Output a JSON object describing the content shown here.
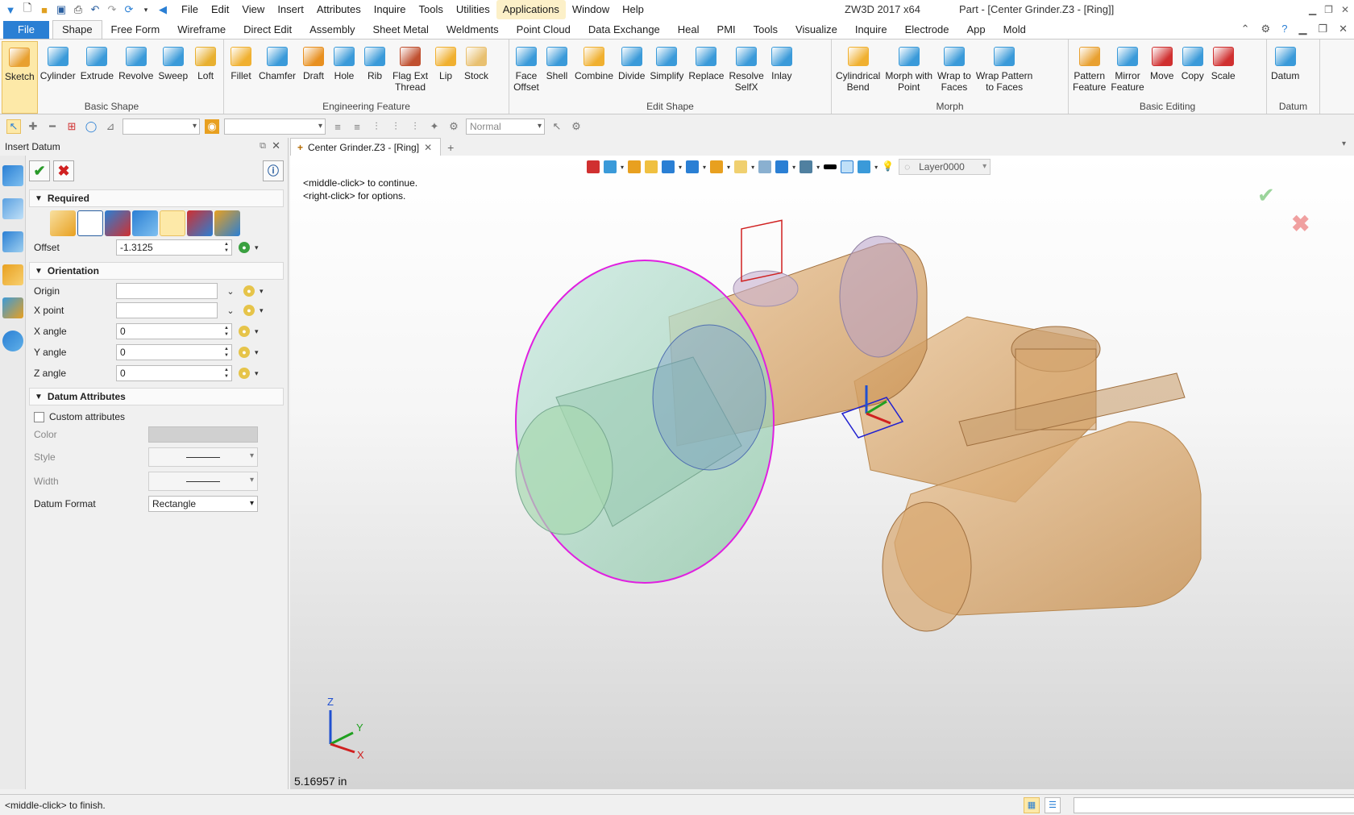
{
  "window": {
    "app_title": "ZW3D 2017  x64",
    "doc_title": "Part - [Center Grinder.Z3 - [Ring]]"
  },
  "menu": [
    "File",
    "Edit",
    "View",
    "Insert",
    "Attributes",
    "Inquire",
    "Tools",
    "Utilities",
    "Applications",
    "Window",
    "Help"
  ],
  "ribbon_tabs": [
    "File",
    "Shape",
    "Free Form",
    "Wireframe",
    "Direct Edit",
    "Assembly",
    "Sheet Metal",
    "Weldments",
    "Point Cloud",
    "Data Exchange",
    "Heal",
    "PMI",
    "Tools",
    "Visualize",
    "Inquire",
    "Electrode",
    "App",
    "Mold"
  ],
  "active_ribbon_tab": "Shape",
  "ribbon_groups": [
    {
      "label": "Basic Shape",
      "buttons": [
        {
          "label": "Sketch",
          "icon": "sketch-icon",
          "color": "#e8a030"
        },
        {
          "label": "Cylinder",
          "icon": "cylinder-icon",
          "color": "#3a9ad9"
        },
        {
          "label": "Extrude",
          "icon": "extrude-icon",
          "color": "#3a9ad9"
        },
        {
          "label": "Revolve",
          "icon": "revolve-icon",
          "color": "#3a9ad9"
        },
        {
          "label": "Sweep",
          "icon": "sweep-icon",
          "color": "#3a9ad9"
        },
        {
          "label": "Loft",
          "icon": "loft-icon",
          "color": "#e8b030"
        }
      ]
    },
    {
      "label": "Engineering Feature",
      "buttons": [
        {
          "label": "Fillet",
          "icon": "fillet-icon",
          "color": "#f0b030"
        },
        {
          "label": "Chamfer",
          "icon": "chamfer-icon",
          "color": "#3a9ad9"
        },
        {
          "label": "Draft",
          "icon": "draft-icon",
          "color": "#e89020"
        },
        {
          "label": "Hole",
          "icon": "hole-icon",
          "color": "#3a9ad9"
        },
        {
          "label": "Rib",
          "icon": "rib-icon",
          "color": "#3a9ad9"
        },
        {
          "label": "Flag Ext\nThread",
          "icon": "thread-icon",
          "color": "#c05030"
        },
        {
          "label": "Lip",
          "icon": "lip-icon",
          "color": "#f0b030"
        },
        {
          "label": "Stock",
          "icon": "stock-icon",
          "color": "#e8c070"
        }
      ]
    },
    {
      "label": "Edit Shape",
      "buttons": [
        {
          "label": "Face\nOffset",
          "icon": "face-offset-icon",
          "color": "#3a9ad9"
        },
        {
          "label": "Shell",
          "icon": "shell-icon",
          "color": "#3a9ad9"
        },
        {
          "label": "Combine",
          "icon": "combine-icon",
          "color": "#f0b030"
        },
        {
          "label": "Divide",
          "icon": "divide-icon",
          "color": "#3a9ad9"
        },
        {
          "label": "Simplify",
          "icon": "simplify-icon",
          "color": "#3a9ad9"
        },
        {
          "label": "Replace",
          "icon": "replace-icon",
          "color": "#3a9ad9"
        },
        {
          "label": "Resolve\nSelfX",
          "icon": "resolve-selfx-icon",
          "color": "#3a9ad9"
        },
        {
          "label": "Inlay",
          "icon": "inlay-icon",
          "color": "#3a9ad9"
        }
      ]
    },
    {
      "label": "Morph",
      "buttons": [
        {
          "label": "Cylindrical\nBend",
          "icon": "cylindrical-bend-icon",
          "color": "#f0b030"
        },
        {
          "label": "Morph with\nPoint",
          "icon": "morph-point-icon",
          "color": "#3a9ad9"
        },
        {
          "label": "Wrap to\nFaces",
          "icon": "wrap-faces-icon",
          "color": "#3a9ad9"
        },
        {
          "label": "Wrap Pattern\nto Faces",
          "icon": "wrap-pattern-icon",
          "color": "#3a9ad9"
        }
      ]
    },
    {
      "label": "Basic Editing",
      "buttons": [
        {
          "label": "Pattern\nFeature",
          "icon": "pattern-icon",
          "color": "#e8a030"
        },
        {
          "label": "Mirror\nFeature",
          "icon": "mirror-icon",
          "color": "#3a9ad9"
        },
        {
          "label": "Move",
          "icon": "move-icon",
          "color": "#d03030"
        },
        {
          "label": "Copy",
          "icon": "copy-icon",
          "color": "#3a9ad9"
        },
        {
          "label": "Scale",
          "icon": "scale-icon",
          "color": "#d03030"
        }
      ]
    },
    {
      "label": "Datum",
      "buttons": [
        {
          "label": "Datum",
          "icon": "datum-icon",
          "color": "#3a9ad9"
        }
      ]
    }
  ],
  "toolbar2": {
    "filter_value": "Normal"
  },
  "panel": {
    "title": "Insert Datum",
    "required_label": "Required",
    "offset_label": "Offset",
    "offset_value": "-1.3125",
    "orientation_label": "Orientation",
    "origin_label": "Origin",
    "xpoint_label": "X point",
    "xangle_label": "X angle",
    "xangle_value": "0",
    "yangle_label": "Y angle",
    "yangle_value": "0",
    "zangle_label": "Z angle",
    "zangle_value": "0",
    "datum_attr_label": "Datum Attributes",
    "custom_attr_label": "Custom attributes",
    "color_label": "Color",
    "style_label": "Style",
    "width_label": "Width",
    "format_label": "Datum Format",
    "format_value": "Rectangle"
  },
  "doc_tab": {
    "label": "Center Grinder.Z3 - [Ring]"
  },
  "viewport": {
    "prompt_line1": "<middle-click> to continue.",
    "prompt_line2": "<right-click> for options.",
    "layer": "Layer0000",
    "distance": "5.16957 in",
    "triad_z": "Z",
    "triad_y": "Y",
    "triad_x": "X"
  },
  "statusbar": {
    "message": "<middle-click> to finish."
  },
  "colors": {
    "accent": "#2a7fd4",
    "highlight": "#fde9a8",
    "model_bronze": "#d9a86a",
    "model_green": "#a8d8c0",
    "selection_magenta": "#e020e0"
  }
}
